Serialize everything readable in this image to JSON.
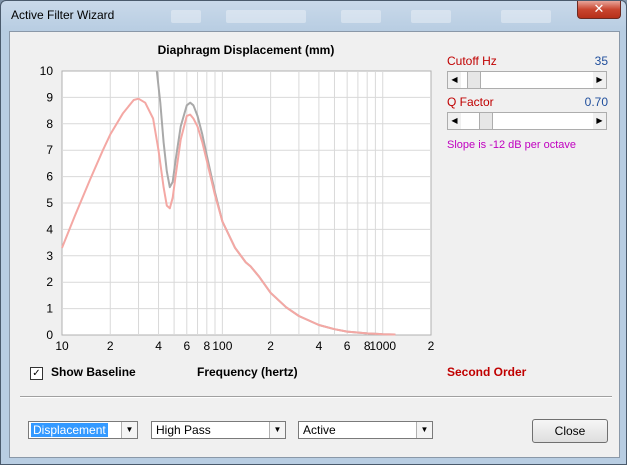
{
  "window": {
    "title": "Active Filter Wizard",
    "close_glyph": "✕"
  },
  "chart_data": {
    "type": "line",
    "title": "Diaphragm Displacement (mm)",
    "xlabel": "Frequency (hertz)",
    "ylabel": "",
    "x_scale": "log",
    "xlim": [
      10,
      2000
    ],
    "ylim": [
      0,
      10
    ],
    "y_ticks": [
      0,
      1,
      2,
      3,
      4,
      5,
      6,
      7,
      8,
      9,
      10
    ],
    "x_tick_labels": [
      {
        "x": 10,
        "label": "10"
      },
      {
        "x": 20,
        "label": "2"
      },
      {
        "x": 40,
        "label": "4"
      },
      {
        "x": 60,
        "label": "6"
      },
      {
        "x": 80,
        "label": "8"
      },
      {
        "x": 100,
        "label": "100"
      },
      {
        "x": 200,
        "label": "2"
      },
      {
        "x": 400,
        "label": "4"
      },
      {
        "x": 600,
        "label": "6"
      },
      {
        "x": 800,
        "label": "8"
      },
      {
        "x": 1000,
        "label": "1000"
      },
      {
        "x": 2000,
        "label": "2"
      }
    ],
    "grid": true,
    "series": [
      {
        "color": "#a9a9a9",
        "x": [
          39,
          41,
          43,
          45,
          47,
          49,
          51,
          55,
          60,
          63,
          66,
          70,
          75,
          80,
          90,
          100,
          120,
          140,
          150,
          170,
          200,
          250,
          300,
          400,
          500,
          600,
          800,
          1000,
          1200
        ],
        "y": [
          10,
          8.8,
          7.3,
          6.2,
          5.6,
          5.8,
          6.6,
          7.9,
          8.7,
          8.8,
          8.7,
          8.3,
          7.6,
          6.8,
          5.4,
          4.3,
          3.3,
          2.75,
          2.6,
          2.2,
          1.6,
          1.05,
          0.72,
          0.38,
          0.22,
          0.13,
          0.06,
          0.03,
          0.02
        ]
      },
      {
        "color": "#f4a8a4",
        "x": [
          10,
          12,
          15,
          18,
          20,
          24,
          28,
          30,
          33,
          37,
          40,
          43,
          45,
          47,
          49,
          51,
          55,
          60,
          63,
          66,
          70,
          75,
          80,
          90,
          100,
          120,
          140,
          150,
          170,
          200,
          250,
          300,
          400,
          500,
          600,
          800,
          1000,
          1200
        ],
        "y": [
          3.3,
          4.5,
          5.9,
          7.0,
          7.6,
          8.4,
          8.9,
          8.95,
          8.8,
          8.2,
          7.0,
          5.6,
          4.9,
          4.8,
          5.2,
          6.0,
          7.4,
          8.3,
          8.35,
          8.2,
          7.9,
          7.3,
          6.6,
          5.3,
          4.3,
          3.3,
          2.75,
          2.6,
          2.2,
          1.6,
          1.05,
          0.72,
          0.38,
          0.22,
          0.13,
          0.06,
          0.03,
          0.02
        ]
      }
    ]
  },
  "controls": {
    "cutoff": {
      "label": "Cutoff  Hz",
      "value": "35",
      "position": 0.05
    },
    "q_factor": {
      "label": "Q Factor",
      "value": "0.70",
      "position": 0.15
    },
    "slope_text": "Slope is -12 dB per octave",
    "show_baseline_label": "Show Baseline",
    "show_baseline_checked": "✓",
    "order_label": "Second Order"
  },
  "bottom": {
    "mode": "Displacement",
    "filter_type": "High Pass",
    "filter_kind": "Active",
    "close_label": "Close"
  },
  "colors": {
    "accent_red": "#c00000",
    "accent_blue": "#1f4e9c",
    "slope_magenta": "#c000c0"
  }
}
